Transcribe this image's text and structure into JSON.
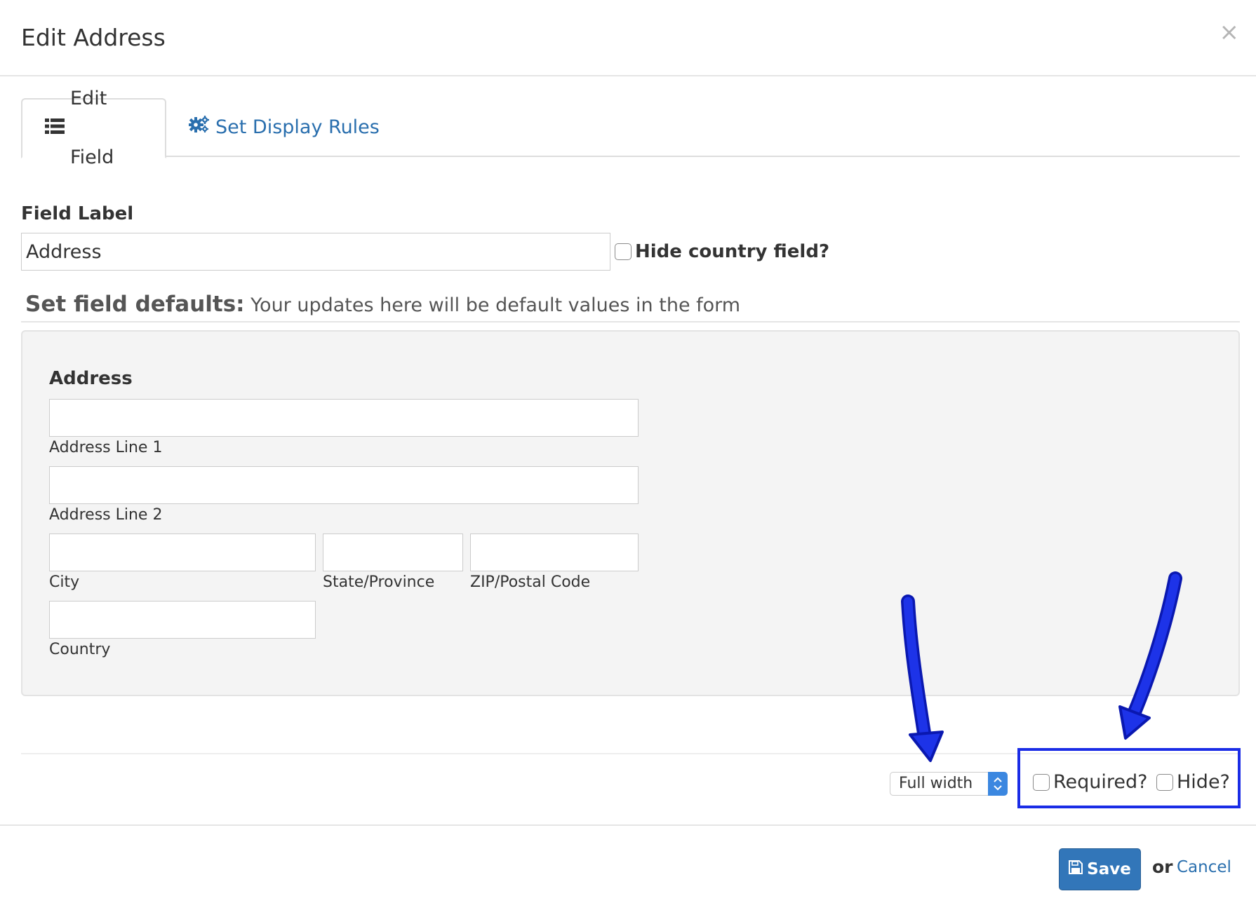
{
  "modal": {
    "title": "Edit Address",
    "close_glyph": "×"
  },
  "tabs": [
    {
      "label": "Edit Field",
      "icon": "list-icon",
      "active": true
    },
    {
      "label": "Set Display Rules",
      "icon": "gears-icon",
      "active": false
    }
  ],
  "field_label": {
    "title": "Field Label",
    "value": "Address",
    "hide_country_label": "Hide country field?",
    "hide_country_checked": false
  },
  "defaults": {
    "heading_bold": "Set field defaults:",
    "heading_text": " Your updates here will be default values in the form",
    "address_title": "Address",
    "fields": [
      {
        "name": "address-line-1",
        "label": "Address Line 1",
        "value": ""
      },
      {
        "name": "address-line-2",
        "label": "Address Line 2",
        "value": ""
      },
      {
        "name": "city",
        "label": "City",
        "value": ""
      },
      {
        "name": "state-province",
        "label": "State/Province",
        "value": ""
      },
      {
        "name": "zip-postal-code",
        "label": "ZIP/Postal Code",
        "value": ""
      },
      {
        "name": "country",
        "label": "Country",
        "value": ""
      }
    ]
  },
  "options": {
    "width_select": "Full width",
    "required_label": "Required?",
    "required_checked": false,
    "hide_label": "Hide?",
    "hide_checked": false
  },
  "footer": {
    "save_label": "Save",
    "or_text": "or",
    "cancel_label": "Cancel"
  },
  "colors": {
    "link": "#2a6fae",
    "primary_button": "#3276b9",
    "annotation": "#1a2ce6"
  }
}
